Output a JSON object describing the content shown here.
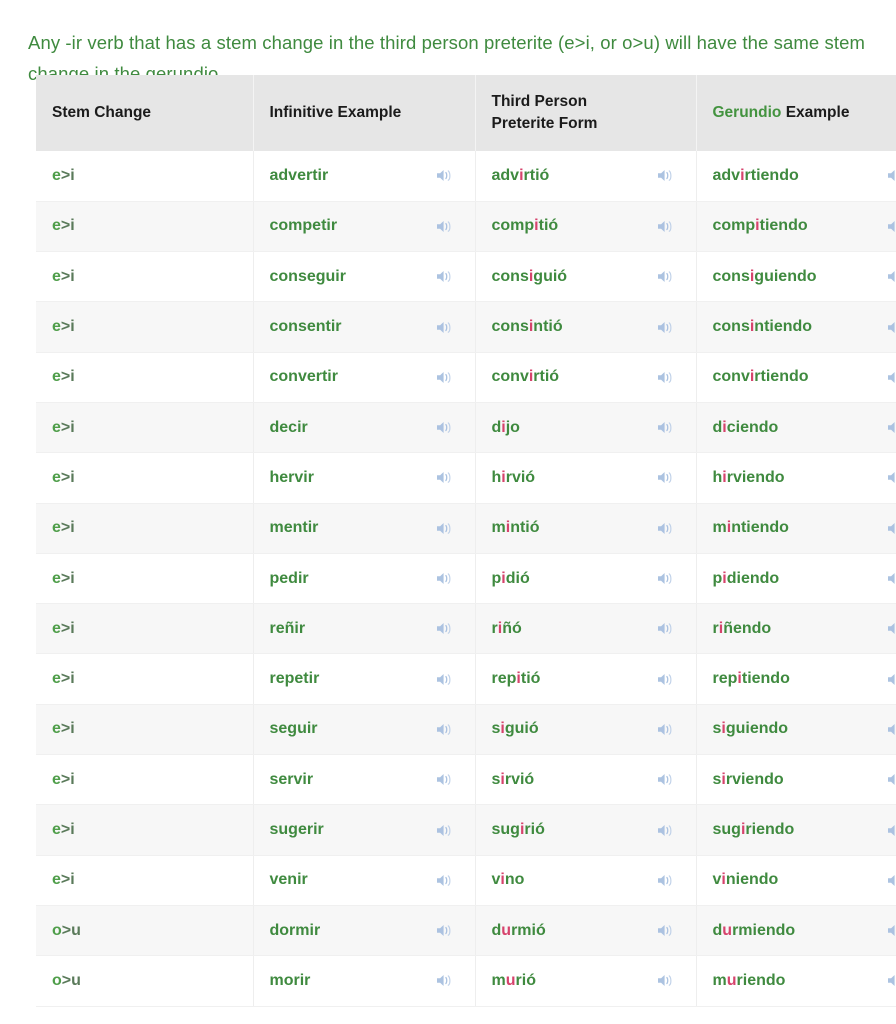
{
  "intro": {
    "text": "Any -ir verb that has a stem change in the third person preterite (e>i, or o>u) will have the same stem change in the gerundio."
  },
  "colors": {
    "green": "#3f8a3f",
    "header_green": "#43933f",
    "highlight_red": "#d6436c",
    "header_bg": "#e6e6e6",
    "row_alt_bg": "#f7f7f7",
    "speaker_blue": "#9db9dd"
  },
  "table": {
    "headers": [
      {
        "label": "Stem Change",
        "green_part": "",
        "black_part": "Stem Change"
      },
      {
        "label": "Infinitive Example",
        "green_part": "",
        "black_part": "Infinitive Example"
      },
      {
        "label": "Third Person Preterite Form",
        "green_part": "",
        "black_part": "Third Person Preterite Form",
        "line1": "Third Person",
        "line2": "Preterite Form"
      },
      {
        "label": "Gerundio Example",
        "green_part": "Gerundio",
        "black_part": " Example"
      },
      {
        "label": "",
        "green_part": "",
        "black_part": ""
      }
    ],
    "icon": "speaker-icon",
    "rows": [
      {
        "stem_a": "e",
        "stem_b": ">i",
        "infinitive": "advertir",
        "preterite": [
          {
            "t": "adv",
            "hl": false
          },
          {
            "t": "i",
            "hl": true
          },
          {
            "t": "rtió",
            "hl": false
          }
        ],
        "gerundio": [
          {
            "t": "adv",
            "hl": false
          },
          {
            "t": "i",
            "hl": true
          },
          {
            "t": "rtiendo",
            "hl": false
          }
        ]
      },
      {
        "stem_a": "e",
        "stem_b": ">i",
        "infinitive": "competir",
        "preterite": [
          {
            "t": "comp",
            "hl": false
          },
          {
            "t": "i",
            "hl": true
          },
          {
            "t": "tió",
            "hl": false
          }
        ],
        "gerundio": [
          {
            "t": "comp",
            "hl": false
          },
          {
            "t": "i",
            "hl": true
          },
          {
            "t": "tiendo",
            "hl": false
          }
        ]
      },
      {
        "stem_a": "e",
        "stem_b": ">i",
        "infinitive": "conseguir",
        "preterite": [
          {
            "t": "cons",
            "hl": false
          },
          {
            "t": "i",
            "hl": true
          },
          {
            "t": "guió",
            "hl": false
          }
        ],
        "gerundio": [
          {
            "t": "cons",
            "hl": false
          },
          {
            "t": "i",
            "hl": true
          },
          {
            "t": "guiendo",
            "hl": false
          }
        ]
      },
      {
        "stem_a": "e",
        "stem_b": ">i",
        "infinitive": "consentir",
        "preterite": [
          {
            "t": "cons",
            "hl": false
          },
          {
            "t": "i",
            "hl": true
          },
          {
            "t": "ntió",
            "hl": false
          }
        ],
        "gerundio": [
          {
            "t": "cons",
            "hl": false
          },
          {
            "t": "i",
            "hl": true
          },
          {
            "t": "ntiendo",
            "hl": false
          }
        ]
      },
      {
        "stem_a": "e",
        "stem_b": ">i",
        "infinitive": "convertir",
        "preterite": [
          {
            "t": "conv",
            "hl": false
          },
          {
            "t": "i",
            "hl": true
          },
          {
            "t": "rtió",
            "hl": false
          }
        ],
        "gerundio": [
          {
            "t": "conv",
            "hl": false
          },
          {
            "t": "i",
            "hl": true
          },
          {
            "t": "rtiendo",
            "hl": false
          }
        ]
      },
      {
        "stem_a": "e",
        "stem_b": ">i",
        "infinitive": "decir",
        "preterite": [
          {
            "t": "d",
            "hl": false
          },
          {
            "t": "i",
            "hl": true
          },
          {
            "t": "jo",
            "hl": false
          }
        ],
        "gerundio": [
          {
            "t": "d",
            "hl": false
          },
          {
            "t": "i",
            "hl": true
          },
          {
            "t": "ciendo",
            "hl": false
          }
        ]
      },
      {
        "stem_a": "e",
        "stem_b": ">i",
        "infinitive": "hervir",
        "preterite": [
          {
            "t": "h",
            "hl": false
          },
          {
            "t": "i",
            "hl": true
          },
          {
            "t": "rvió",
            "hl": false
          }
        ],
        "gerundio": [
          {
            "t": "h",
            "hl": false
          },
          {
            "t": "i",
            "hl": true
          },
          {
            "t": "rviendo",
            "hl": false
          }
        ]
      },
      {
        "stem_a": "e",
        "stem_b": ">i",
        "infinitive": "mentir",
        "preterite": [
          {
            "t": "m",
            "hl": false
          },
          {
            "t": "i",
            "hl": true
          },
          {
            "t": "ntió",
            "hl": false
          }
        ],
        "gerundio": [
          {
            "t": "m",
            "hl": false
          },
          {
            "t": "i",
            "hl": true
          },
          {
            "t": "ntiendo",
            "hl": false
          }
        ]
      },
      {
        "stem_a": "e",
        "stem_b": ">i",
        "infinitive": "pedir",
        "preterite": [
          {
            "t": "p",
            "hl": false
          },
          {
            "t": "i",
            "hl": true
          },
          {
            "t": "dió",
            "hl": false
          }
        ],
        "gerundio": [
          {
            "t": "p",
            "hl": false
          },
          {
            "t": "i",
            "hl": true
          },
          {
            "t": "diendo",
            "hl": false
          }
        ]
      },
      {
        "stem_a": "e",
        "stem_b": ">i",
        "infinitive": "reñir",
        "preterite": [
          {
            "t": "r",
            "hl": false
          },
          {
            "t": "i",
            "hl": true
          },
          {
            "t": "ñó",
            "hl": false
          }
        ],
        "gerundio": [
          {
            "t": "r",
            "hl": false
          },
          {
            "t": "i",
            "hl": true
          },
          {
            "t": "ñendo",
            "hl": false
          }
        ]
      },
      {
        "stem_a": "e",
        "stem_b": ">i",
        "infinitive": "repetir",
        "preterite": [
          {
            "t": "rep",
            "hl": false
          },
          {
            "t": "i",
            "hl": true
          },
          {
            "t": "tió",
            "hl": false
          }
        ],
        "gerundio": [
          {
            "t": "rep",
            "hl": false
          },
          {
            "t": "i",
            "hl": true
          },
          {
            "t": "tiendo",
            "hl": false
          }
        ]
      },
      {
        "stem_a": "e",
        "stem_b": ">i",
        "infinitive": "seguir",
        "preterite": [
          {
            "t": "s",
            "hl": false
          },
          {
            "t": "i",
            "hl": true
          },
          {
            "t": "guió",
            "hl": false
          }
        ],
        "gerundio": [
          {
            "t": "s",
            "hl": false
          },
          {
            "t": "i",
            "hl": true
          },
          {
            "t": "guiendo",
            "hl": false
          }
        ]
      },
      {
        "stem_a": "e",
        "stem_b": ">i",
        "infinitive": "servir",
        "preterite": [
          {
            "t": "s",
            "hl": false
          },
          {
            "t": "i",
            "hl": true
          },
          {
            "t": "rvió",
            "hl": false
          }
        ],
        "gerundio": [
          {
            "t": "s",
            "hl": false
          },
          {
            "t": "i",
            "hl": true
          },
          {
            "t": "rviendo",
            "hl": false
          }
        ]
      },
      {
        "stem_a": "e",
        "stem_b": ">i",
        "infinitive": "sugerir",
        "preterite": [
          {
            "t": "sug",
            "hl": false
          },
          {
            "t": "i",
            "hl": true
          },
          {
            "t": "rió",
            "hl": false
          }
        ],
        "gerundio": [
          {
            "t": "sug",
            "hl": false
          },
          {
            "t": "i",
            "hl": true
          },
          {
            "t": "riendo",
            "hl": false
          }
        ]
      },
      {
        "stem_a": "e",
        "stem_b": ">i",
        "infinitive": "venir",
        "preterite": [
          {
            "t": "v",
            "hl": false
          },
          {
            "t": "i",
            "hl": true
          },
          {
            "t": "no",
            "hl": false
          }
        ],
        "gerundio": [
          {
            "t": "v",
            "hl": false
          },
          {
            "t": "i",
            "hl": true
          },
          {
            "t": "niendo",
            "hl": false
          }
        ]
      },
      {
        "stem_a": "o",
        "stem_b": ">u",
        "infinitive": "dormir",
        "preterite": [
          {
            "t": "d",
            "hl": false
          },
          {
            "t": "u",
            "hl": true
          },
          {
            "t": "rmió",
            "hl": false
          }
        ],
        "gerundio": [
          {
            "t": "d",
            "hl": false
          },
          {
            "t": "u",
            "hl": true
          },
          {
            "t": "rmiendo",
            "hl": false
          }
        ]
      },
      {
        "stem_a": "o",
        "stem_b": ">u",
        "infinitive": "morir",
        "preterite": [
          {
            "t": "m",
            "hl": false
          },
          {
            "t": "u",
            "hl": true
          },
          {
            "t": "rió",
            "hl": false
          }
        ],
        "gerundio": [
          {
            "t": "m",
            "hl": false
          },
          {
            "t": "u",
            "hl": true
          },
          {
            "t": "riendo",
            "hl": false
          }
        ]
      }
    ]
  }
}
